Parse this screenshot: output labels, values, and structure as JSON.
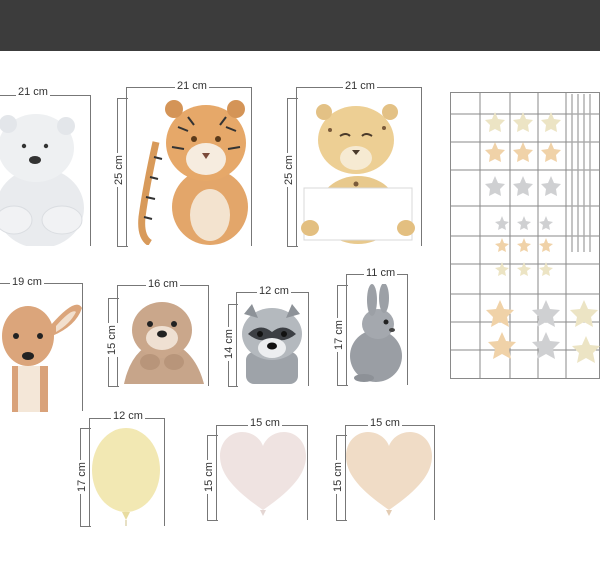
{
  "stickers": [
    {
      "name": "polar-bear",
      "width": "21 cm"
    },
    {
      "name": "tiger",
      "width": "21 cm",
      "height": "25 cm"
    },
    {
      "name": "cheetah",
      "width": "21 cm",
      "height": "25 cm"
    },
    {
      "name": "deer",
      "width": "19 cm"
    },
    {
      "name": "otter",
      "width": "16 cm",
      "height": "15 cm"
    },
    {
      "name": "raccoon",
      "width": "12 cm",
      "height": "14 cm"
    },
    {
      "name": "rabbit",
      "width": "11 cm",
      "height": "17 cm"
    },
    {
      "name": "yellow-balloon",
      "width": "12 cm",
      "height": "17 cm"
    },
    {
      "name": "pink-heart-balloon",
      "width": "15 cm",
      "height": "15 cm"
    },
    {
      "name": "peach-heart-balloon",
      "width": "15 cm",
      "height": "15 cm"
    }
  ],
  "colors": {
    "topbar": "#3c3c3c",
    "star_cream": "#ece4c4",
    "star_peach": "#f0d2a8",
    "star_grey": "#cfd0d2",
    "balloon_yellow": "#f2e8b3",
    "heart_pink": "#efe3e1",
    "heart_peach": "#f0dcc6"
  }
}
